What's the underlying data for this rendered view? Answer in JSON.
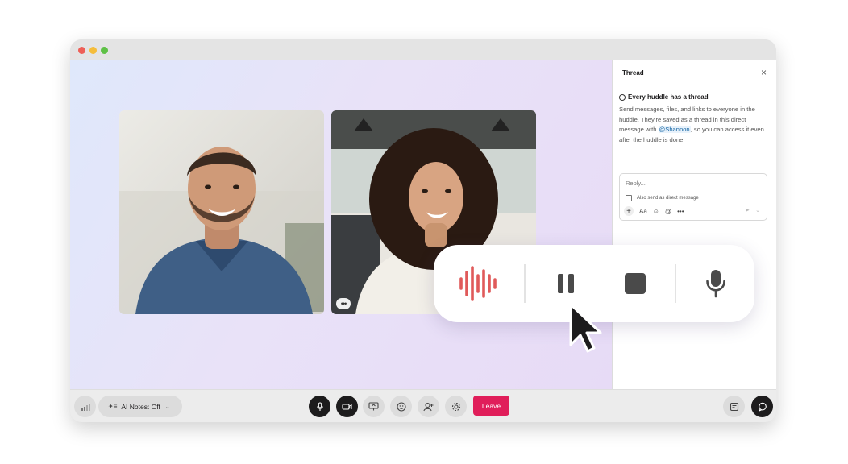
{
  "window": {
    "traffic_lights": [
      "close",
      "minimize",
      "zoom"
    ]
  },
  "video_tiles": [
    {
      "participant": "man",
      "more_label": "•••"
    },
    {
      "participant": "woman",
      "more_label": "•••"
    }
  ],
  "thread_panel": {
    "title": "Thread",
    "close_icon": "×",
    "info_title": "Every huddle has a thread",
    "info_text_before": "Send messages, files, and links to everyone in the huddle. They’re saved as a thread in this direct message with ",
    "mention": "@Shannon",
    "info_text_after": ", so you can access it even after the huddle is done.",
    "reply_placeholder": "Reply...",
    "also_send_label": "Also send as direct message",
    "tools": [
      "+",
      "Aa",
      "☺",
      "@",
      "•••"
    ],
    "send_icon": "➤",
    "caret_icon": "⌄"
  },
  "bottom_bar": {
    "ai_notes_label": "AI Notes: Off",
    "ai_notes_icon": "sparkle-list-icon",
    "leave_label": "Leave",
    "leave_color": "#e01e5a"
  },
  "recording_controls": {
    "icons": [
      "waveform-icon",
      "pause-icon",
      "stop-icon",
      "microphone-icon"
    ],
    "waveform_color": "#e05a5a",
    "control_color": "#4a4a4a"
  }
}
